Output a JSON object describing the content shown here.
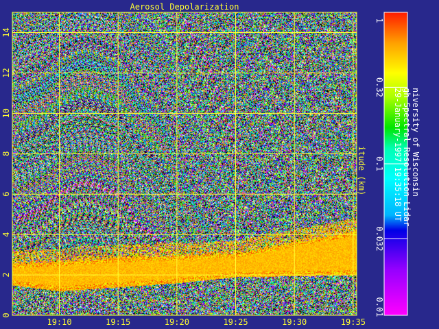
{
  "chart_data": {
    "type": "heatmap",
    "title": "Aerosol Depolarization",
    "xlabel": "",
    "ylabel": "itude (km)",
    "x_ticks": [
      "19:10",
      "19:15",
      "19:20",
      "19:25",
      "19:30",
      "19:35"
    ],
    "x_range": [
      "19:06",
      "19:35"
    ],
    "y_ticks": [
      "0",
      "2",
      "4",
      "6",
      "8",
      "10",
      "12",
      "14"
    ],
    "y_range": [
      0,
      15
    ],
    "colorbar": {
      "scale": "log",
      "range": [
        0.01,
        1
      ],
      "ticks": [
        "0.01",
        "0.032",
        "0.1",
        "0.32",
        "1"
      ]
    },
    "features": {
      "aerosol_layer_base_km": [
        1.5,
        1.2,
        1.4,
        1.6,
        1.9,
        2.0
      ],
      "aerosol_layer_top_km": [
        2.6,
        2.7,
        2.9,
        3.0,
        3.1,
        4.2
      ],
      "layer_times": [
        "19:06",
        "19:10",
        "19:15",
        "19:20",
        "19:25",
        "19:35"
      ],
      "layer_depolarization": 0.55
    },
    "grid": true
  },
  "annotation": {
    "lines": [
      "niversity of Wisconsin",
      "gh Spectral Resolution Lidar",
      "29-January-1997 19:35:18 UT"
    ]
  },
  "colors": {
    "background": "#28288c",
    "grid": "#ffff33",
    "text": "#ffff33"
  }
}
